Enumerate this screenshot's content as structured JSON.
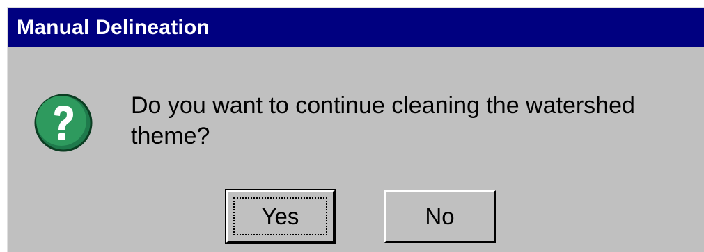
{
  "window": {
    "title": "Manual Delineation"
  },
  "dialog": {
    "icon": "question-icon",
    "message": "Do you want to continue cleaning the watershed theme?"
  },
  "buttons": {
    "yes_label": "Yes",
    "no_label": "No"
  },
  "colors": {
    "titlebar": "#000080",
    "dialog_bg": "#c0c0c0",
    "icon_green": "#2e8b57"
  }
}
